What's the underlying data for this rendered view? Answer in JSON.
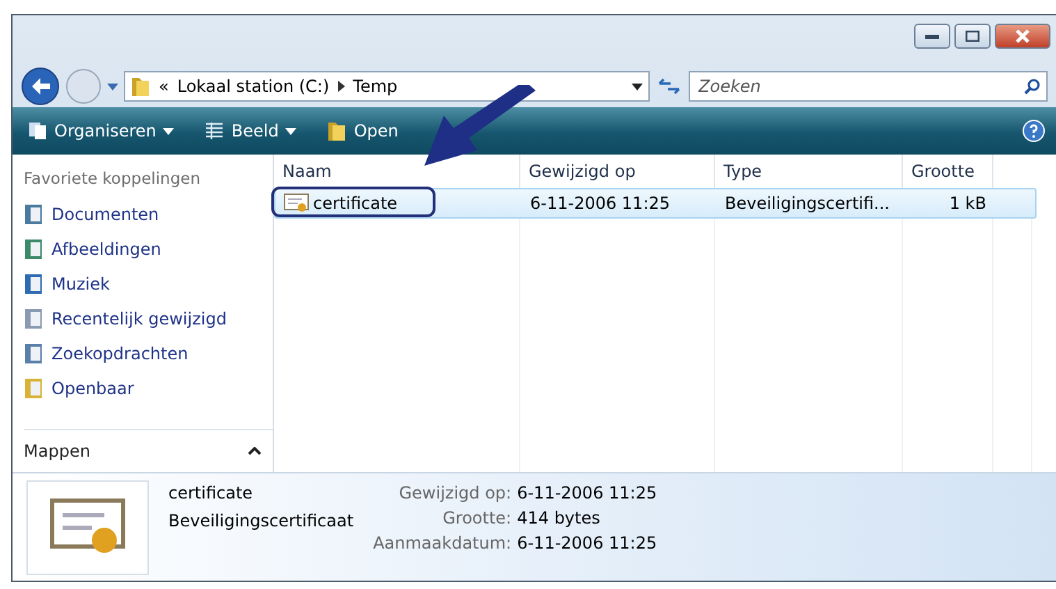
{
  "address": {
    "prefix": "«",
    "segments": [
      "Lokaal station (C:)",
      "Temp"
    ]
  },
  "search": {
    "placeholder": "Zoeken"
  },
  "toolbar": [
    {
      "label": "Organiseren",
      "dropdown": true
    },
    {
      "label": "Beeld",
      "dropdown": true
    },
    {
      "label": "Open",
      "dropdown": false
    }
  ],
  "sidebar": {
    "heading": "Favoriete koppelingen",
    "items": [
      "Documenten",
      "Afbeeldingen",
      "Muziek",
      "Recentelijk gewijzigd",
      "Zoekopdrachten",
      "Openbaar"
    ],
    "folders_label": "Mappen"
  },
  "table": {
    "columns": [
      "Naam",
      "Gewijzigd op",
      "Type",
      "Grootte"
    ],
    "rows": [
      {
        "cells": [
          "certificate",
          "6-11-2006 11:25",
          "Beveiligingscertifi...",
          "1 kB"
        ],
        "selected": true
      }
    ]
  },
  "details": {
    "name": "certificate",
    "type": "Beveiligingscertificaat",
    "fields": [
      {
        "label": "Gewijzigd op:",
        "value": "6-11-2006 11:25"
      },
      {
        "label": "Grootte:",
        "value": "414 bytes"
      },
      {
        "label": "Aanmaakdatum:",
        "value": "6-11-2006 11:25"
      }
    ]
  }
}
